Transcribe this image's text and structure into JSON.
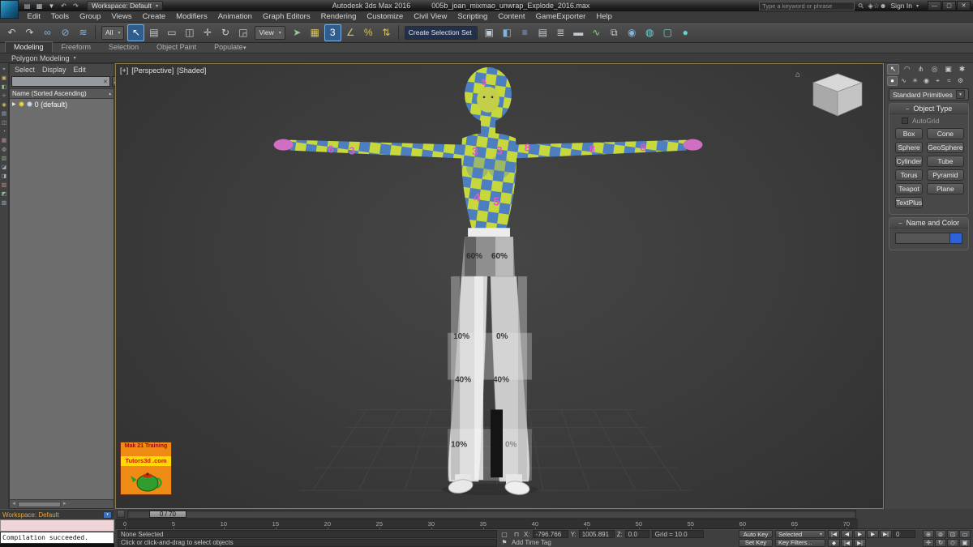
{
  "colors": {
    "texture_yellow": "#c6d83c",
    "texture_blue": "#4d7fc0",
    "texture_pink": "#e257c6",
    "accent_blue": "#2f62d8",
    "viewport_border": "#8f7b4a",
    "workspace_text": "#e8a33d"
  },
  "icons": {
    "chevron_down": "▾",
    "chevron_up": "▴",
    "collapse": "−",
    "close": "✕",
    "search": "⚲",
    "sort_ascending": "▲",
    "time_tag_flag": "⚑",
    "isolate": "▢",
    "lock": "⊓",
    "home": "⌂",
    "expander": "▶",
    "scroll_left": "◄",
    "scroll_right": "►"
  },
  "title_bar": {
    "app_title": "Autodesk 3ds Max 2016",
    "doc_title": "005b_joan_mixmao_unwrap_Explode_2016.max",
    "workspace_label": "Workspace: Default",
    "search_placeholder": "Type a keyword or phrase",
    "sign_in_label": "Sign In",
    "quick_access": [
      {
        "name": "new-scene-icon",
        "glyph": "▤"
      },
      {
        "name": "open-file-icon",
        "glyph": "▦"
      },
      {
        "name": "save-file-icon",
        "glyph": "▼"
      },
      {
        "name": "undo-scene-operation-icon",
        "glyph": "↶"
      },
      {
        "name": "redo-scene-operation-icon",
        "glyph": "↷"
      }
    ],
    "right_icons": [
      {
        "name": "communication-center-icon",
        "glyph": "◈"
      },
      {
        "name": "favorites-icon",
        "glyph": "☆"
      },
      {
        "name": "user-icon",
        "glyph": "☻"
      }
    ],
    "window_buttons": [
      {
        "name": "minimize-button",
        "glyph": "—"
      },
      {
        "name": "restore-button",
        "glyph": "▢"
      },
      {
        "name": "close-button",
        "glyph": "✕"
      }
    ]
  },
  "menus": [
    {
      "label": "Edit",
      "name": "menu-edit"
    },
    {
      "label": "Tools",
      "name": "menu-tools"
    },
    {
      "label": "Group",
      "name": "menu-group"
    },
    {
      "label": "Views",
      "name": "menu-views"
    },
    {
      "label": "Create",
      "name": "menu-create"
    },
    {
      "label": "Modifiers",
      "name": "menu-modifiers"
    },
    {
      "label": "Animation",
      "name": "menu-animation"
    },
    {
      "label": "Graph Editors",
      "name": "menu-graph-editors"
    },
    {
      "label": "Rendering",
      "name": "menu-rendering"
    },
    {
      "label": "Customize",
      "name": "menu-customize"
    },
    {
      "label": "Civil View",
      "name": "menu-civil-view"
    },
    {
      "label": "Scripting",
      "name": "menu-scripting"
    },
    {
      "label": "Content",
      "name": "menu-content"
    },
    {
      "label": "GameExporter",
      "name": "menu-gameexporter"
    },
    {
      "label": "Help",
      "name": "menu-help"
    }
  ],
  "toolbar": {
    "filter_value": "All",
    "view_value": "View",
    "selection_set_value": "Create Selection Set",
    "group1": [
      {
        "name": "undo-icon",
        "glyph": "↶"
      },
      {
        "name": "redo-icon",
        "glyph": "↷"
      },
      {
        "name": "select-and-link-icon",
        "glyph": "∞",
        "cls": "c-blue"
      },
      {
        "name": "unlink-selection-icon",
        "glyph": "⊘",
        "cls": "c-blue"
      },
      {
        "name": "bind-to-space-warp-icon",
        "glyph": "≋",
        "cls": "c-blue"
      }
    ],
    "group2": [
      {
        "name": "select-object-icon",
        "glyph": "↖",
        "cls": "active"
      },
      {
        "name": "select-by-name-icon",
        "glyph": "▤"
      },
      {
        "name": "rectangular-selection-region-icon",
        "glyph": "▭"
      },
      {
        "name": "window-crossing-toggle-icon",
        "glyph": "◫"
      },
      {
        "name": "select-and-move-icon",
        "glyph": "✛"
      },
      {
        "name": "select-and-rotate-icon",
        "glyph": "↻"
      },
      {
        "name": "select-and-scale-icon",
        "glyph": "◲"
      }
    ],
    "group3": [
      {
        "name": "select-and-manipulate-icon",
        "glyph": "➤",
        "cls": "c-green"
      },
      {
        "name": "keyboard-shortcut-override-icon",
        "glyph": "▦",
        "cls": "c-yellow"
      },
      {
        "name": "snaps-toggle-icon",
        "glyph": "3",
        "cls": "active"
      },
      {
        "name": "angle-snap-icon",
        "glyph": "∠",
        "cls": "c-yellow"
      },
      {
        "name": "percent-snap-icon",
        "glyph": "%",
        "cls": "c-yellow"
      },
      {
        "name": "spinner-snap-icon",
        "glyph": "⇅",
        "cls": "c-yellow"
      }
    ],
    "group4": [
      {
        "name": "edit-named-selection-sets-icon",
        "glyph": "▣"
      },
      {
        "name": "mirror-icon",
        "glyph": "◧",
        "cls": "c-blue"
      },
      {
        "name": "align-icon",
        "glyph": "≡",
        "cls": "c-blue"
      },
      {
        "name": "toggle-scene-explorer-icon",
        "glyph": "▤"
      },
      {
        "name": "toggle-layer-explorer-icon",
        "glyph": "≣"
      },
      {
        "name": "toggle-ribbon-icon",
        "glyph": "▬"
      },
      {
        "name": "curve-editor-icon",
        "glyph": "∿",
        "cls": "c-green"
      },
      {
        "name": "schematic-view-icon",
        "glyph": "⧉"
      },
      {
        "name": "material-editor-icon",
        "glyph": "◉",
        "cls": "c-blue"
      },
      {
        "name": "render-setup-icon",
        "glyph": "◍",
        "cls": "c-teal"
      },
      {
        "name": "rendered-frame-window-icon",
        "glyph": "▢",
        "cls": "c-teal"
      },
      {
        "name": "render-production-icon",
        "glyph": "●",
        "cls": "c-teal"
      }
    ]
  },
  "ribbon": {
    "tabs": [
      {
        "label": "Modeling",
        "name": "tab-modeling",
        "cls": "active"
      },
      {
        "label": "Freeform",
        "name": "tab-freeform"
      },
      {
        "label": "Selection",
        "name": "tab-selection"
      },
      {
        "label": "Object Paint",
        "name": "tab-object-paint"
      },
      {
        "label": "Populate",
        "name": "tab-populate"
      }
    ],
    "subtab": "Polygon Modeling"
  },
  "explorer": {
    "menu": [
      {
        "label": "Select",
        "name": "explorer-menu-select"
      },
      {
        "label": "Display",
        "name": "explorer-menu-display"
      },
      {
        "label": "Edit",
        "name": "explorer-menu-edit"
      }
    ],
    "header": "Name (Sorted Ascending)",
    "item_label": "0 (default)",
    "strip": [
      "⌖",
      "▣",
      "◧",
      "✛",
      "◉",
      "▤",
      "◫",
      "◔",
      "▦",
      "◍",
      "▥",
      "◪",
      "◨",
      "▧",
      "◩",
      "▨"
    ]
  },
  "viewport": {
    "label_plus": "[+]",
    "label_pov": "[Perspective]",
    "label_shading": "[Shaded]",
    "ad_line1": "Mak 21 Training",
    "ad_line2": "Tutors3d .com"
  },
  "character": {
    "numbers": {
      "head": "5",
      "chest_l": "3",
      "chest_r": "3",
      "shoulder_r": "8",
      "belly_l": "4",
      "belly_r": "5",
      "arm_l_outer": "6",
      "arm_l_inner": "3",
      "arm_r_inner": "8",
      "arm_r_outer": "8"
    },
    "pants": {
      "hip_l": "60%",
      "hip_r": "60%",
      "thigh_l": "10%",
      "thigh_r": "0%",
      "knee_l": "40%",
      "knee_r": "40%",
      "shin_l": "10%",
      "shin_r": "0%"
    }
  },
  "panel": {
    "tabs": [
      {
        "name": "create-tab-icon",
        "glyph": "↖",
        "cls": "active"
      },
      {
        "name": "modify-tab-icon",
        "glyph": "◠"
      },
      {
        "name": "hierarchy-tab-icon",
        "glyph": "⋔"
      },
      {
        "name": "motion-tab-icon",
        "glyph": "◎"
      },
      {
        "name": "display-tab-icon",
        "glyph": "▣"
      },
      {
        "name": "utilities-tab-icon",
        "glyph": "✱"
      }
    ],
    "categories": [
      {
        "name": "geometry-category-icon",
        "glyph": "●",
        "cls": "active"
      },
      {
        "name": "shapes-category-icon",
        "glyph": "∿"
      },
      {
        "name": "lights-category-icon",
        "glyph": "☀"
      },
      {
        "name": "cameras-category-icon",
        "glyph": "◉"
      },
      {
        "name": "helpers-category-icon",
        "glyph": "⌖"
      },
      {
        "name": "space-warps-category-icon",
        "glyph": "≈"
      },
      {
        "name": "systems-category-icon",
        "glyph": "⚙"
      }
    ],
    "dropdown_value": "Standard Primitives",
    "rollout_object_type": "Object Type",
    "autogrid_label": "AutoGrid",
    "object_buttons": [
      "Box",
      "Cone",
      "Sphere",
      "GeoSphere",
      "Cylinder",
      "Tube",
      "Torus",
      "Pyramid",
      "Teapot",
      "Plane",
      "TextPlus"
    ],
    "rollout_name_color": "Name and Color"
  },
  "timeline": {
    "slider_label": "0 / 70",
    "ticks": [
      "0",
      "5",
      "10",
      "15",
      "20",
      "25",
      "30",
      "35",
      "40",
      "45",
      "50",
      "55",
      "60",
      "65",
      "70"
    ]
  },
  "status_bar": {
    "selection_status": "None Selected",
    "prompt": "Click or click-and-drag to select objects",
    "x_label": "X:",
    "y_label": "Y:",
    "z_label": "Z:",
    "x_value": "-796.766",
    "y_value": "1005.891",
    "z_value": "0.0",
    "grid_info": "Grid = 10.0",
    "add_time_tag": "Add Time Tag",
    "auto_key": "Auto Key",
    "set_key": "Set Key",
    "key_mode_value": "Selected",
    "key_filters": "Key Filters...",
    "time_value": "0",
    "transport1": [
      {
        "name": "goto-start-button",
        "glyph": "|◀"
      },
      {
        "name": "previous-frame-button",
        "glyph": "◀"
      },
      {
        "name": "play-button",
        "glyph": "▶"
      },
      {
        "name": "next-frame-button",
        "glyph": "▶"
      },
      {
        "name": "goto-end-button",
        "glyph": "▶|"
      }
    ],
    "transport2": [
      {
        "name": "key-mode-toggle-icon",
        "glyph": "◆"
      },
      {
        "name": "previous-key-button",
        "glyph": "|◀"
      },
      {
        "name": "next-key-button",
        "glyph": "▶|"
      }
    ],
    "nav1": [
      {
        "name": "zoom-icon",
        "glyph": "⊕"
      },
      {
        "name": "zoom-all-icon",
        "glyph": "⊚"
      },
      {
        "name": "zoom-extents-icon",
        "glyph": "⊡"
      },
      {
        "name": "zoom-region-icon",
        "glyph": "▭"
      }
    ],
    "nav2": [
      {
        "name": "pan-icon",
        "glyph": "✛"
      },
      {
        "name": "orbit-icon",
        "glyph": "↻"
      },
      {
        "name": "field-of-view-icon",
        "glyph": "◇"
      },
      {
        "name": "maximize-viewport-icon",
        "glyph": "▣"
      }
    ]
  },
  "bottom_left": {
    "workspace_label": "Workspace: Default",
    "listener_text": "Compilation succeeded."
  }
}
